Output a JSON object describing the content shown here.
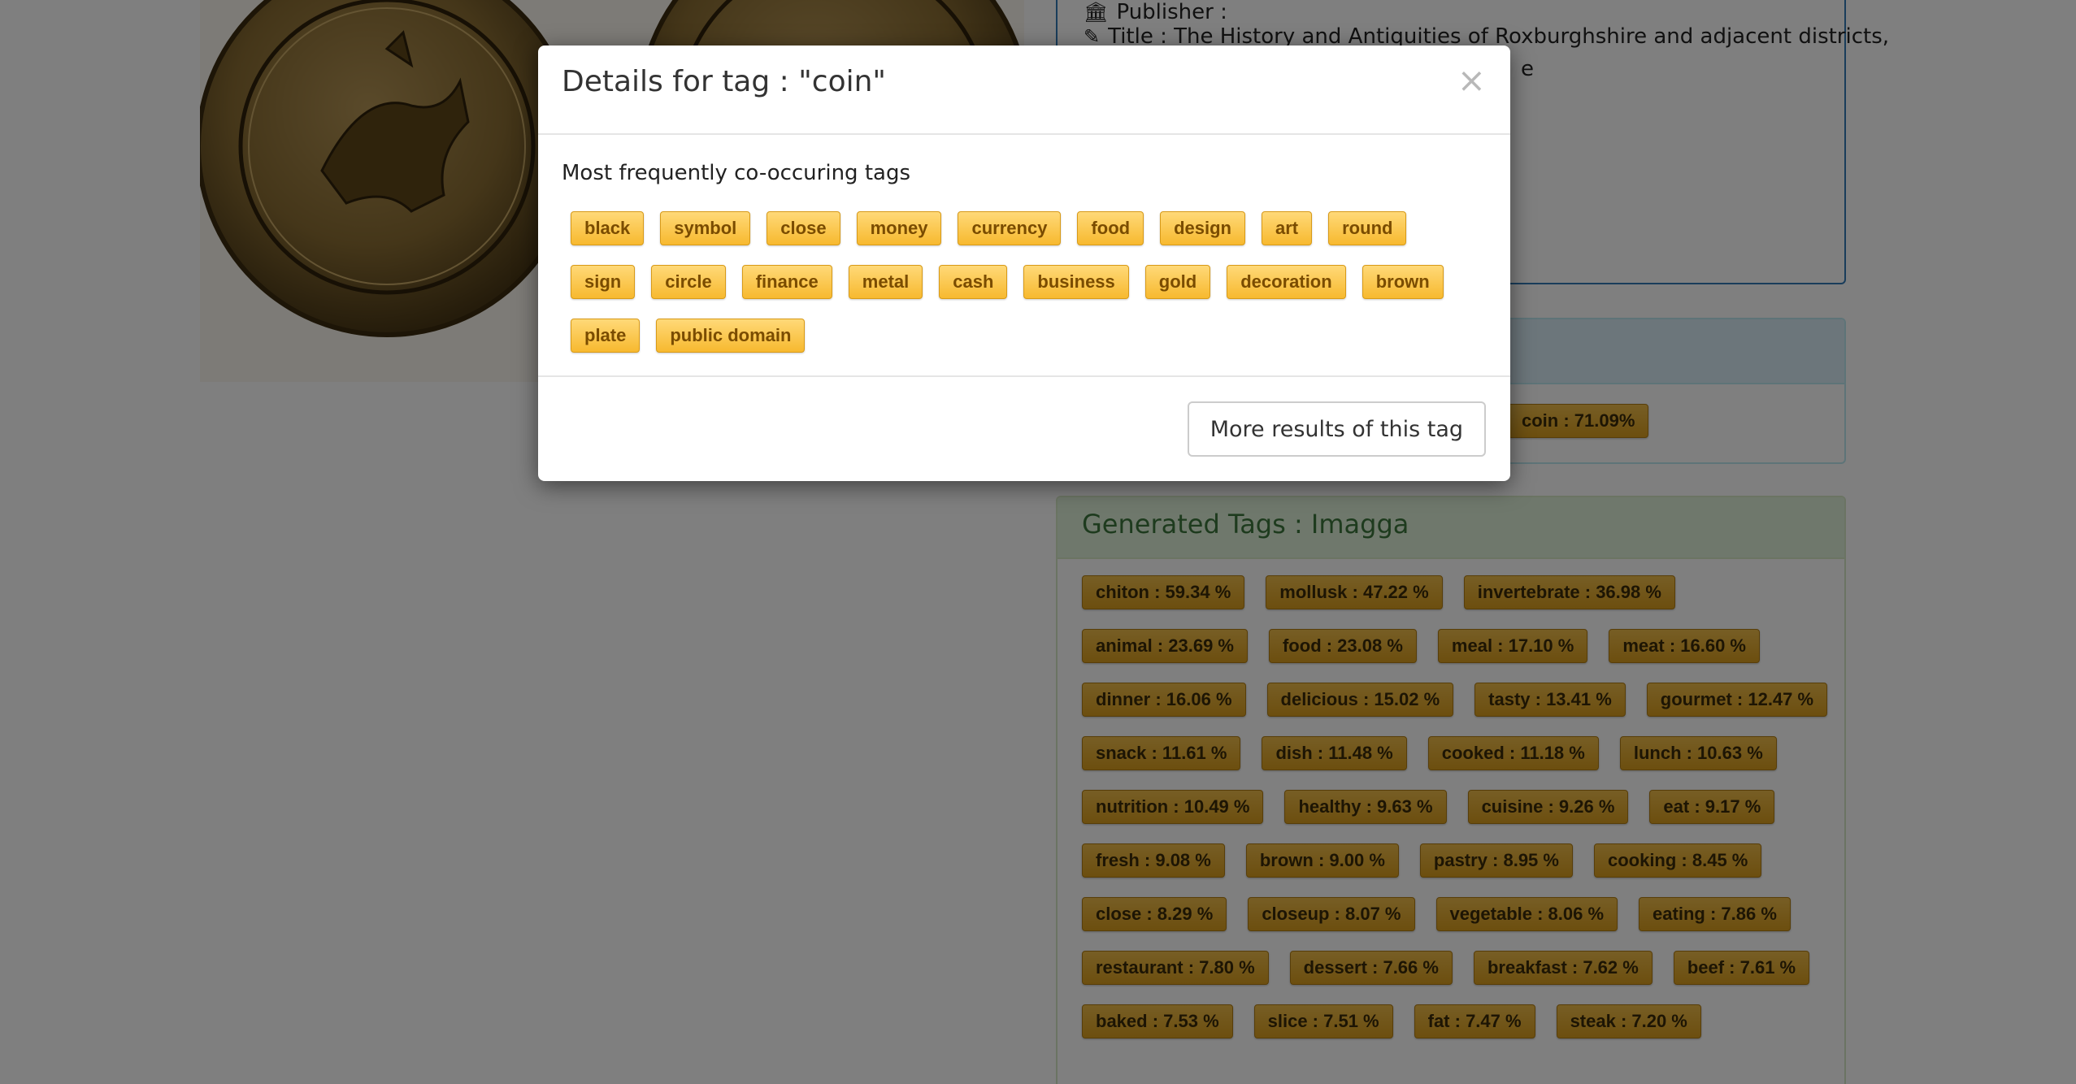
{
  "background": {
    "metadata": {
      "publisher_label": "Publisher :",
      "title_line": "Title : The History and Antiquities of Roxburghshire and adjacent districts,",
      "title_tail": "e"
    },
    "coin_tag": "coin : 71.09%",
    "imagga_panel": {
      "title": "Generated Tags : Imagga",
      "tags": [
        "chiton : 59.34 %",
        "mollusk : 47.22 %",
        "invertebrate : 36.98 %",
        "animal : 23.69 %",
        "food : 23.08 %",
        "meal : 17.10 %",
        "meat : 16.60 %",
        "dinner : 16.06 %",
        "delicious : 15.02 %",
        "tasty : 13.41 %",
        "gourmet : 12.47 %",
        "snack : 11.61 %",
        "dish : 11.48 %",
        "cooked : 11.18 %",
        "lunch : 10.63 %",
        "nutrition : 10.49 %",
        "healthy : 9.63 %",
        "cuisine : 9.26 %",
        "eat : 9.17 %",
        "fresh : 9.08 %",
        "brown : 9.00 %",
        "pastry : 8.95 %",
        "cooking : 8.45 %",
        "close : 8.29 %",
        "closeup : 8.07 %",
        "vegetable : 8.06 %",
        "eating : 7.86 %",
        "restaurant : 7.80 %",
        "dessert : 7.66 %",
        "breakfast : 7.62 %",
        "beef : 7.61 %",
        "baked : 7.53 %",
        "slice : 7.51 %",
        "fat : 7.47 %",
        "steak : 7.20 %"
      ]
    }
  },
  "modal": {
    "title": "Details for tag : \"coin\"",
    "close_symbol": "×",
    "section_title": "Most frequently co-occuring tags",
    "tags": [
      "black",
      "symbol",
      "close",
      "money",
      "currency",
      "food",
      "design",
      "art",
      "round",
      "sign",
      "circle",
      "finance",
      "metal",
      "cash",
      "business",
      "gold",
      "decoration",
      "brown",
      "plate",
      "public domain"
    ],
    "more_button": "More results of this tag"
  },
  "colors": {
    "tag_light_top": "#ffd978",
    "tag_light_bottom": "#f7b92f",
    "tag_dark_top": "#eebc4a",
    "tag_dark_bottom": "#d99d1e",
    "overlay": "rgba(0,0,0,0.5)"
  },
  "icons": {
    "publisher": "bank-icon",
    "title": "pencil-icon",
    "close": "close-icon"
  }
}
